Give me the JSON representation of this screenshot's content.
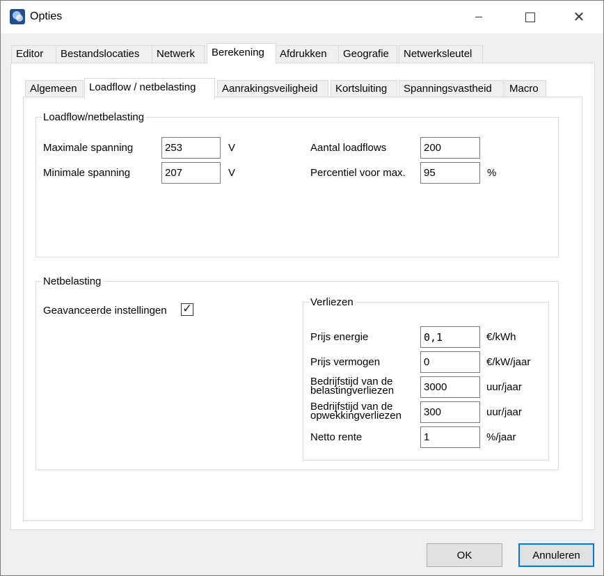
{
  "window": {
    "title": "Opties",
    "app_icon": "app-logo-icon",
    "min_icon": "minimize-icon",
    "max_icon": "maximize-icon",
    "close_icon": "close-icon",
    "close_glyph": "✕"
  },
  "top_tabs": [
    "Editor",
    "Bestandslocaties",
    "Netwerk",
    "Berekening",
    "Afdrukken",
    "Geografie",
    "Netwerksleutel"
  ],
  "top_tab_active": "Berekening",
  "sub_tabs": [
    "Algemeen",
    "Loadflow / netbelasting",
    "Aanrakingsveiligheid",
    "Kortsluiting",
    "Spanningsvastheid",
    "Macro"
  ],
  "sub_tab_active": "Loadflow / netbelasting",
  "loadflow": {
    "legend": "Loadflow/netbelasting",
    "max_spanning": {
      "label": "Maximale spanning",
      "value": "253",
      "unit": "V"
    },
    "min_spanning": {
      "label": "Minimale spanning",
      "value": "207",
      "unit": "V"
    },
    "aantal": {
      "label": "Aantal loadflows",
      "value": "200"
    },
    "percentiel": {
      "label": "Percentiel voor max.",
      "value": "95",
      "unit": "%"
    }
  },
  "netbelasting": {
    "legend": "Netbelasting",
    "geavanceerd": {
      "label": "Geavanceerde instellingen",
      "checked": true,
      "check_glyph": "✓"
    }
  },
  "verliezen": {
    "legend": "Verliezen",
    "prijs_energie": {
      "label": "Prijs energie",
      "value": "0,1",
      "unit": "€/kWh"
    },
    "prijs_vermogen": {
      "label": "Prijs vermogen",
      "value": "0",
      "unit": "€/kW/jaar"
    },
    "bedrijfstijd_belasting": {
      "label_line1": "Bedrijfstijd van de",
      "label_line2": "belastingverliezen",
      "value": "3000",
      "unit": "uur/jaar"
    },
    "bedrijfstijd_opwekking": {
      "label_line1": "Bedrijfstijd van de",
      "label_line2": "opwekkingverliezen",
      "value": "300",
      "unit": "uur/jaar"
    },
    "netto_rente": {
      "label": "Netto rente",
      "value": "1",
      "unit": "%/jaar"
    }
  },
  "buttons": {
    "ok": "OK",
    "cancel": "Annuleren"
  },
  "colors": {
    "focus_border": "#0078d7",
    "button_bg": "#e1e1e1",
    "panel_bg": "#ffffff",
    "window_bg": "#f0f0f0"
  }
}
